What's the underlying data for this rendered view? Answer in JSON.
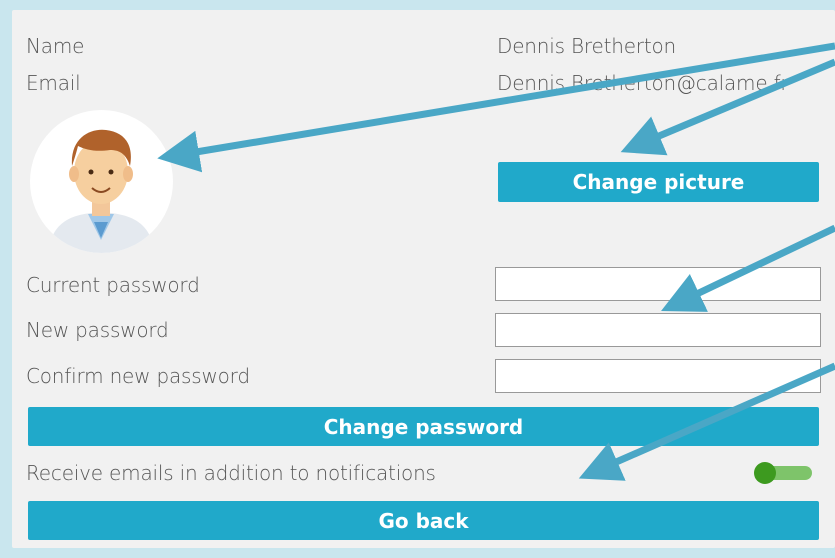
{
  "profile": {
    "name_label": "Name",
    "name_value": "Dennis Bretherton",
    "email_label": "Email",
    "email_value": "Dennis.Bretherton@calame.fr",
    "change_picture_label": "Change picture"
  },
  "password": {
    "current_label": "Current password",
    "current_value": "",
    "new_label": "New password",
    "new_value": "",
    "confirm_label": "Confirm new password",
    "confirm_value": "",
    "change_button_label": "Change password"
  },
  "notifications": {
    "email_toggle_label": "Receive emails in addition to notifications",
    "email_toggle_on": true
  },
  "footer": {
    "go_back_label": "Go back"
  },
  "colors": {
    "accent": "#20a9ca",
    "toggle_on": "#3d9a1f",
    "arrow": "#4aa7c6"
  }
}
